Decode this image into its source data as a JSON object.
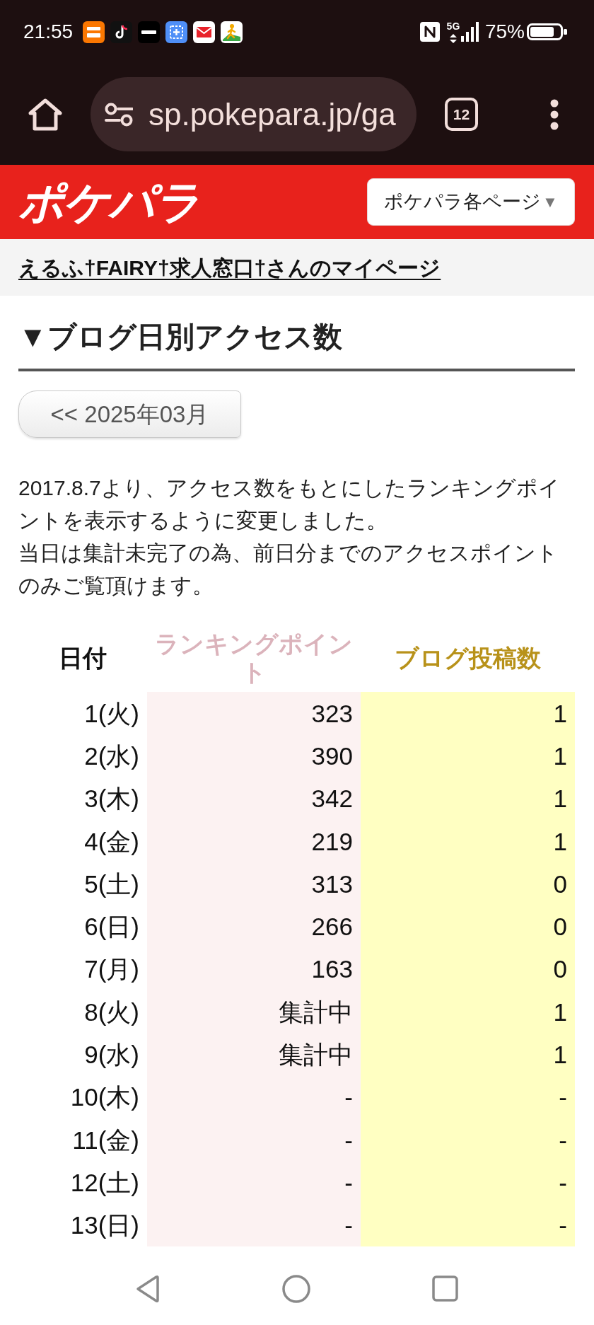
{
  "status_bar": {
    "time": "21:55",
    "network": "5G",
    "battery": "75%"
  },
  "browser": {
    "url": "sp.pokepara.jp/ga",
    "tab_count": "12"
  },
  "site_header": {
    "logo": "ポケパラ",
    "menu_button": {
      "label": "ポケパラ各ページ",
      "caret": "▼"
    }
  },
  "mypage_link": "えるふ†FAIRY†求人窓口†さんのマイページ",
  "section_title": "▼ブログ日別アクセス数",
  "prev_month_button": "<< 2025年03月",
  "notice": [
    "2017.8.7より、アクセス数をもとにしたランキングポイントを表示するように変更しました。",
    "当日は集計未完了の為、前日分までのアクセスポイントのみご覧頂けます。"
  ],
  "table": {
    "columns": [
      "日付",
      "ランキングポイント",
      "ブログ投稿数"
    ],
    "rows": [
      [
        "1(火)",
        "323",
        "1"
      ],
      [
        "2(水)",
        "390",
        "1"
      ],
      [
        "3(木)",
        "342",
        "1"
      ],
      [
        "4(金)",
        "219",
        "1"
      ],
      [
        "5(土)",
        "313",
        "0"
      ],
      [
        "6(日)",
        "266",
        "0"
      ],
      [
        "7(月)",
        "163",
        "0"
      ],
      [
        "8(火)",
        "集計中",
        "1"
      ],
      [
        "9(水)",
        "集計中",
        "1"
      ],
      [
        "10(木)",
        "-",
        "-"
      ],
      [
        "11(金)",
        "-",
        "-"
      ],
      [
        "12(土)",
        "-",
        "-"
      ],
      [
        "13(日)",
        "-",
        "-"
      ]
    ]
  }
}
